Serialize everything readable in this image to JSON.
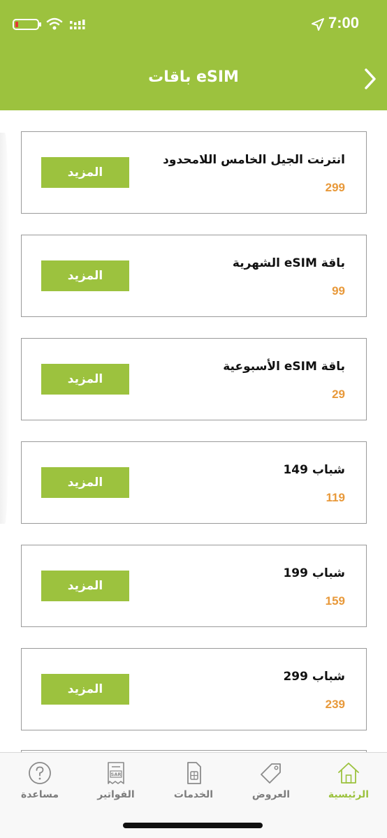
{
  "status": {
    "time": "7:00"
  },
  "header": {
    "title": "باقات eSIM"
  },
  "plans": [
    {
      "name": "انترنت الجيل الخامس اللامحدود",
      "price": "299",
      "button": "المزيد"
    },
    {
      "name": "باقة eSIM الشهرية",
      "price": "99",
      "button": "المزيد"
    },
    {
      "name": "باقة eSIM الأسبوعية",
      "price": "29",
      "button": "المزيد"
    },
    {
      "name": "شباب 149",
      "price": "119",
      "button": "المزيد"
    },
    {
      "name": "شباب 199",
      "price": "159",
      "button": "المزيد"
    },
    {
      "name": "شباب 299",
      "price": "239",
      "button": "المزيد"
    }
  ],
  "tabs": [
    {
      "label": "مساعدة",
      "icon": "help-icon"
    },
    {
      "label": "الفواتير",
      "icon": "bill-icon",
      "icon_text": "SAR"
    },
    {
      "label": "الخدمات",
      "icon": "sim-icon"
    },
    {
      "label": "العروض",
      "icon": "tag-icon"
    },
    {
      "label": "الرئيسية",
      "icon": "home-icon",
      "active": true
    }
  ],
  "colors": {
    "accent": "#9cc23e",
    "price": "#e8993a"
  }
}
